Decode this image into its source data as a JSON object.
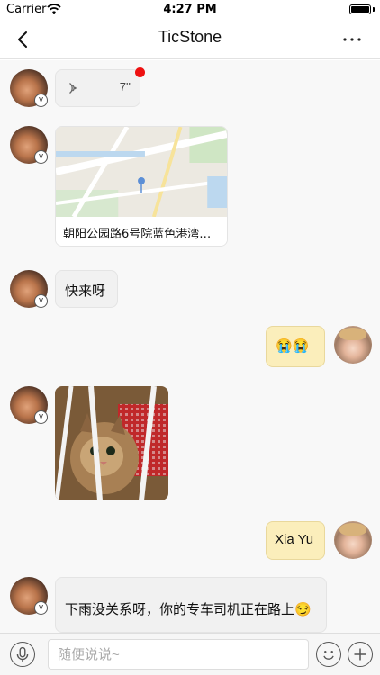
{
  "status_bar": {
    "carrier": "Carrier",
    "time": "4:27 PM",
    "battery_level": 1.0
  },
  "nav": {
    "title": "TicStone",
    "back_icon": "chevron-left-icon",
    "more_icon": "more-dots-icon"
  },
  "messages": {
    "voice": {
      "duration": "7''",
      "unread": true
    },
    "location": {
      "address": "朝阳公园路6号院蓝色港湾国..."
    },
    "text1": {
      "content": "快来呀"
    },
    "emoji": {
      "content": "😭😭"
    },
    "text2": {
      "content": "Xia Yu"
    },
    "text3": {
      "content": "下雨没关系呀，你的专车司机正在路上😏"
    }
  },
  "input_bar": {
    "placeholder": "随便说说~",
    "mic_icon": "microphone-icon",
    "emoji_icon": "emoji-smile-icon",
    "plus_icon": "plus-icon"
  },
  "colors": {
    "incoming_bubble": "#f1f1f1",
    "outgoing_bubble": "#fbeebb",
    "unread_dot": "#ee1111"
  }
}
